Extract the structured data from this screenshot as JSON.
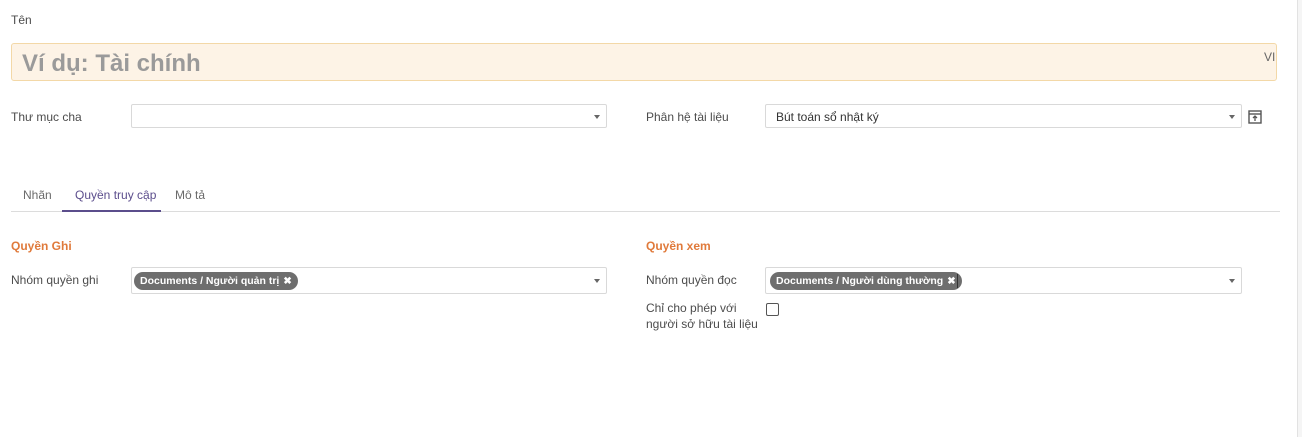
{
  "name_field": {
    "label": "Tên",
    "placeholder": "Ví dụ: Tài chính",
    "lang_badge": "VI"
  },
  "parent_folder": {
    "label": "Thư mục cha",
    "value": ""
  },
  "document_module": {
    "label": "Phân hệ tài liệu",
    "value": "Bút toán sổ nhật ký"
  },
  "tabs": [
    {
      "label": "Nhãn",
      "active": false
    },
    {
      "label": "Quyền truy cập",
      "active": true
    },
    {
      "label": "Mô tả",
      "active": false
    }
  ],
  "write_section": {
    "title": "Quyền Ghi",
    "group_label": "Nhóm quyền ghi",
    "tags": [
      {
        "label": "Documents / Người quản trị",
        "remove_icon": "close-icon"
      }
    ]
  },
  "read_section": {
    "title": "Quyền xem",
    "group_label": "Nhóm quyền đọc",
    "tags": [
      {
        "label": "Documents / Người dùng thường",
        "remove_icon": "close-icon"
      }
    ],
    "owner_only_label_line1": "Chỉ cho phép với",
    "owner_only_label_line2": "người sở hữu tài liệu",
    "owner_only_checked": false
  },
  "colors": {
    "accent": "#5b4d8c",
    "section_title": "#e07a3b",
    "required_bg": "#fdf3e6",
    "tag_bg": "#6e6e6e"
  }
}
